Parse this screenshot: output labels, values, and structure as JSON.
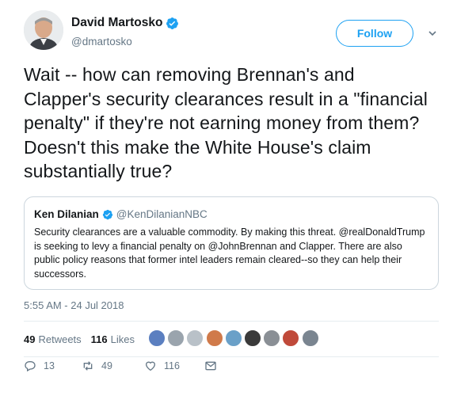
{
  "author": {
    "display_name": "David Martosko",
    "handle": "@dmartosko",
    "verified": true,
    "avatar": "person-avatar"
  },
  "follow_button": {
    "label": "Follow"
  },
  "menu_caret": "chevron-down-icon",
  "tweet": {
    "text": "Wait -- how can removing Brennan's and Clapper's security clearances result in a \"financial penalty\" if they're not earning money from them? Doesn't this make the White House's claim substantially true?"
  },
  "quoted_tweet": {
    "display_name": "Ken Dilanian",
    "handle": "@KenDilanianNBC",
    "verified": true,
    "text": "Security clearances are a valuable commodity.  By making this threat. @realDonaldTrump is seeking to levy a financial penalty on @JohnBrennan and Clapper.  There are also public policy reasons that former intel leaders remain cleared--so they can help their successors."
  },
  "timestamp": "5:55 AM - 24 Jul 2018",
  "stats": {
    "retweets_count": "49",
    "retweets_label": "Retweets",
    "likes_count": "116",
    "likes_label": "Likes"
  },
  "liker_avatars": [
    "#5b7fc0",
    "#9aa4ad",
    "#b9c1c8",
    "#d07a4a",
    "#6aa0c8",
    "#3a3a3a",
    "#8a8f95",
    "#c04a3a",
    "#7a8590"
  ],
  "actions": {
    "reply_count": "13",
    "retweet_count": "49",
    "like_count": "116"
  },
  "colors": {
    "accent": "#1da1f2",
    "text": "#14171a",
    "secondary": "#657786",
    "border": "#ccd6dd"
  }
}
